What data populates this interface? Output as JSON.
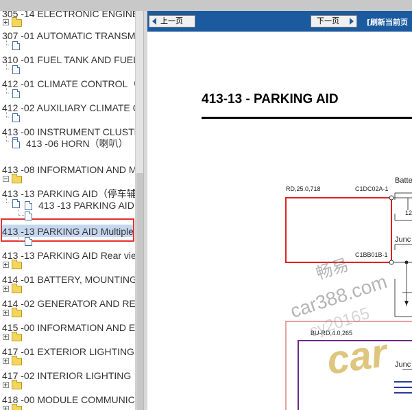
{
  "nav": {
    "prev_label": "上一页",
    "next_label": "下一页",
    "refresh_label": "[刷新当前页"
  },
  "tree": {
    "rows": [
      {
        "label": "305 -14 ELECTRONIC ENGINE C"
      },
      {
        "label": "307 -01 AUTOMATIC TRANSMI"
      },
      {
        "label": "310 -01 FUEL TANK AND FUEL"
      },
      {
        "label": "412 -01 CLIMATE CONTROL（冷"
      },
      {
        "label": "412 -02 AUXILIARY CLIMATE CO"
      },
      {
        "label": "413 -00 INSTRUMENT CLUSTER"
      },
      {
        "label": "413 -06 HORN（喇叭）"
      },
      {
        "label": "413 -08 INFORMATION AND M"
      },
      {
        "label": "413 -13 PARKING AID（停车辅助"
      },
      {
        "label": "413 -13 PARKING AID"
      },
      {
        "label": "413 -13 PARKING AID Multiple"
      },
      {
        "label": "413 -13 PARKING AID Rear view"
      },
      {
        "label": "414 -01 BATTERY, MOUNTING"
      },
      {
        "label": "414 -02 GENERATOR AND REG"
      },
      {
        "label": "415 -00 INFORMATION AND EI"
      },
      {
        "label": "417 -01 EXTERIOR LIGHTING（"
      },
      {
        "label": "417 -02 INTERIOR LIGHTING（室"
      },
      {
        "label": "418 -00 MODULE COMMUNICA"
      }
    ]
  },
  "document": {
    "title": "413-13 - PARKING AID",
    "labels": {
      "wire1": "RD,25.0,718",
      "conn1": "C1DC02A-1",
      "batt": "Batte",
      "num12": "12",
      "junc1": "Junc",
      "conn2": "C1BB01B-1",
      "wire2": "BU-RD,4.0,265",
      "junc2": "Junc"
    }
  },
  "watermarks": {
    "cn": "畅易",
    "site": "car388.com",
    "code": "cy20165",
    "logo": "car"
  },
  "colors": {
    "nav_bg": "#1c5aa0",
    "highlight_red": "#e53030",
    "selection_bg": "#c5d7ee",
    "wire_purple": "#6a2a8a",
    "wire_blue": "#2a3a9a"
  }
}
